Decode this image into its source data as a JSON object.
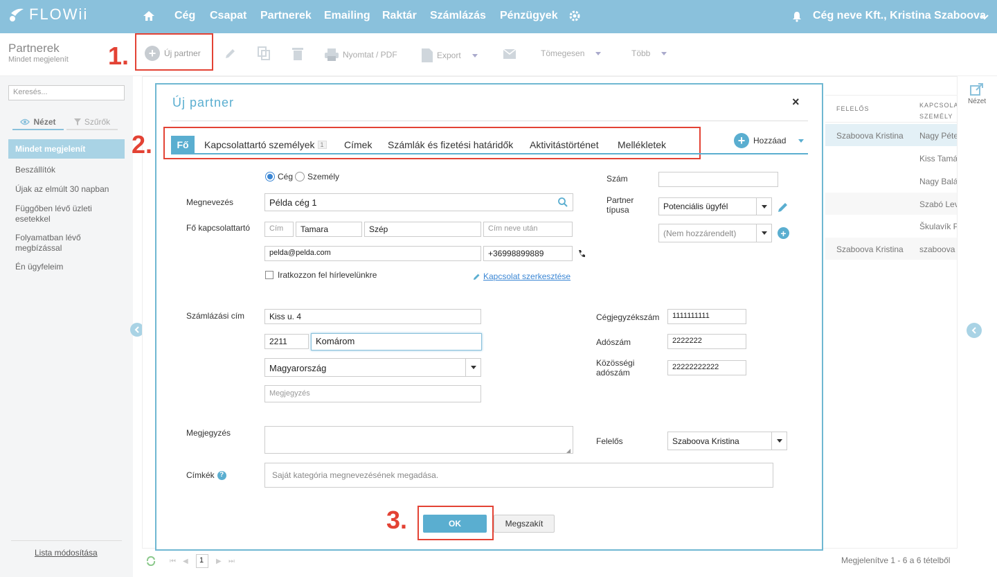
{
  "app": {
    "logo": "FLOWii"
  },
  "nav": {
    "items": [
      "Cég",
      "Csapat",
      "Partnerek",
      "Emailing",
      "Raktár",
      "Számlázás",
      "Pénzügyek"
    ],
    "user": "Cég neve Kft., Kristina Szaboova"
  },
  "page": {
    "title": "Partnerek",
    "subtitle": "Mindet megjelenít"
  },
  "toolbar": {
    "new_partner": "Új partner",
    "print": "Nyomtat / PDF",
    "export": "Export",
    "bulk": "Tömegesen",
    "more": "Több"
  },
  "sidebar": {
    "search_placeholder": "Keresés...",
    "tab_view": "Nézet",
    "tab_filters": "Szűrők",
    "items": [
      "Mindet megjelenít",
      "Beszállítók",
      "Újak az elmúlt 30 napban",
      "Függőben lévő üzleti esetekkel",
      "Folyamatban lévő megbízással",
      "Én ügyfeleim"
    ],
    "footer": "Lista módosítása"
  },
  "bg_table": {
    "headers": [
      "FELELŐS",
      "KAPCSOLA SZEMÉLY"
    ],
    "rows": [
      [
        "Szaboova Kristina",
        "Nagy Péte"
      ],
      [
        "",
        "Kiss Tamá"
      ],
      [
        "",
        "Nagy Balá"
      ],
      [
        "",
        "Szabó Lev"
      ],
      [
        "",
        "Škulavík P"
      ],
      [
        "Szaboova Kristina",
        "szaboova"
      ]
    ],
    "pagination_page": "1",
    "pagination_info": "Megjelenítve 1 - 6 a 6 tételből"
  },
  "right_panel": {
    "view_label": "Nézet"
  },
  "steps": [
    "1.",
    "2.",
    "3."
  ],
  "modal": {
    "title": "Új partner",
    "close": "×",
    "tabs": [
      "Fő",
      "Kapcsolattartó személyek",
      "Címek",
      "Számlák és fizetési határidők",
      "Aktivitástörténet",
      "Mellékletek"
    ],
    "contacts_count": "1",
    "add_label": "Hozzáad",
    "radio_company": "Cég",
    "radio_person": "Személy",
    "name_label": "Megnevezés",
    "name_value": "Példa cég 1",
    "contact_label": "Fő kapcsolattartó",
    "title_placeholder": "Cím",
    "first_name": "Tamara",
    "last_name": "Szép",
    "suffix_placeholder": "Cím neve után",
    "email": "pelda@pelda.com",
    "phone": "+36998899889",
    "newsletter_label": "Iratkozzon fel hírlevelünkre",
    "edit_contact_link": "Kapcsolat szerkesztése",
    "number_label": "Szám",
    "partner_type_label": "Partner típusa",
    "partner_type_value": "Potenciális ügyfél",
    "unassigned_value": "(Nem hozzárendelt)",
    "billing_label": "Számlázási cím",
    "street": "Kiss u. 4",
    "zip": "2211",
    "city": "Komárom",
    "country": "Magyarország",
    "address_note_placeholder": "Megjegyzés",
    "reg_label": "Cégjegyzékszám",
    "reg_value": "1111111111",
    "tax_label": "Adószám",
    "tax_value": "2222222",
    "eu_tax_label": "Közösségi adószám",
    "eu_tax_value": "22222222222",
    "note_label": "Megjegyzés",
    "owner_label": "Felelős",
    "owner_value": "Szaboova Kristina",
    "tags_label": "Címkék",
    "tags_placeholder": "Saját kategória megnevezésének megadása.",
    "ok": "OK",
    "cancel": "Megszakít"
  }
}
